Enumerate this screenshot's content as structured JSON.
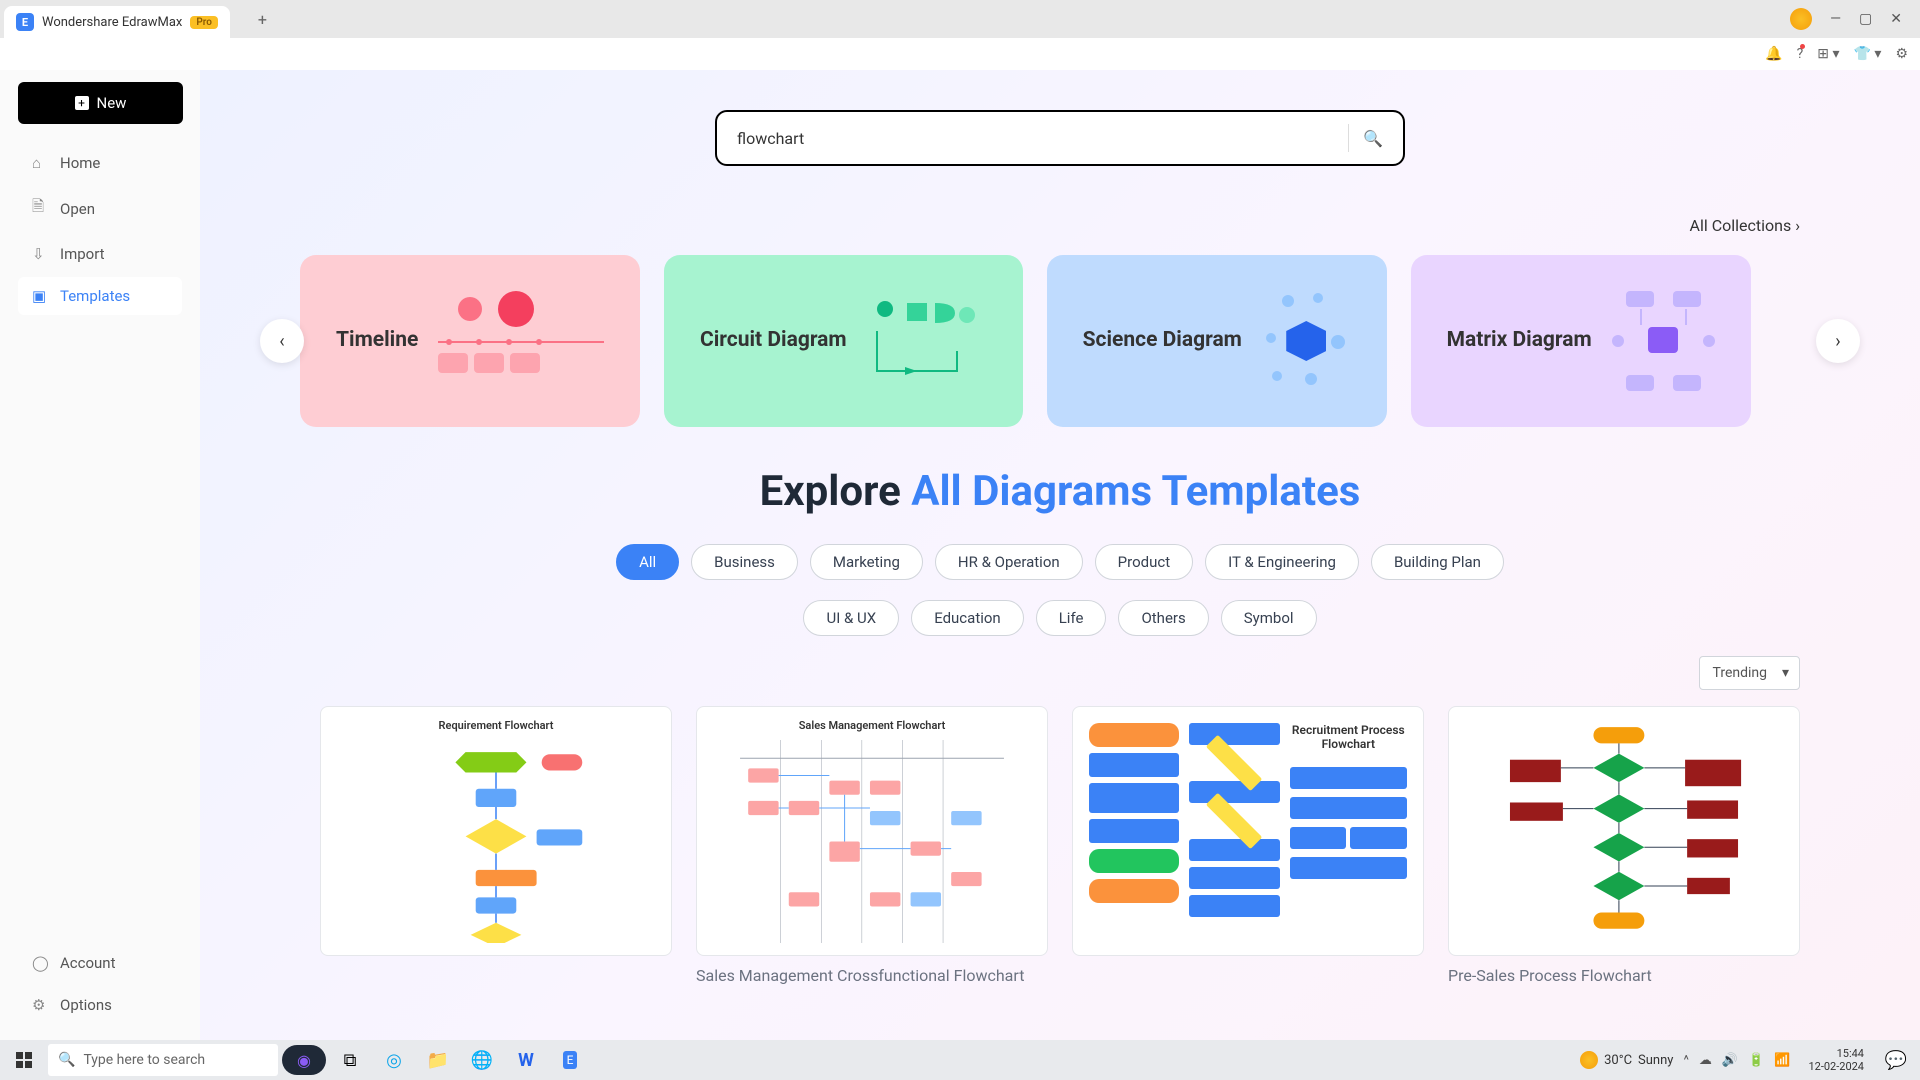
{
  "titlebar": {
    "app_name": "Wondershare EdrawMax",
    "badge": "Pro"
  },
  "toolbar": {
    "new_label": "New"
  },
  "sidebar": {
    "items": [
      {
        "label": "Home",
        "icon": "⌂"
      },
      {
        "label": "Open",
        "icon": "📄"
      },
      {
        "label": "Import",
        "icon": "⬇"
      },
      {
        "label": "Templates",
        "icon": "▣"
      }
    ],
    "footer": [
      {
        "label": "Account",
        "icon": "👤"
      },
      {
        "label": "Options",
        "icon": "⚙"
      }
    ]
  },
  "search": {
    "value": "flowchart"
  },
  "all_collections_label": "All Collections",
  "carousel": {
    "cards": [
      {
        "title": "Timeline"
      },
      {
        "title": "Circuit Diagram"
      },
      {
        "title": "Science Diagram"
      },
      {
        "title": "Matrix Diagram"
      }
    ]
  },
  "explore": {
    "prefix": "Explore ",
    "highlight": "All Diagrams Templates"
  },
  "categories_row1": [
    {
      "label": "All",
      "active": true
    },
    {
      "label": "Business"
    },
    {
      "label": "Marketing"
    },
    {
      "label": "HR & Operation"
    },
    {
      "label": "Product"
    },
    {
      "label": "IT & Engineering"
    },
    {
      "label": "Building Plan"
    }
  ],
  "categories_row2": [
    {
      "label": "UI & UX"
    },
    {
      "label": "Education"
    },
    {
      "label": "Life"
    },
    {
      "label": "Others"
    },
    {
      "label": "Symbol"
    }
  ],
  "sort": {
    "label": "Trending"
  },
  "templates": [
    {
      "thumb_title": "Requirement Flowchart",
      "caption": ""
    },
    {
      "thumb_title": "Sales Management Flowchart",
      "caption": "Sales Management Crossfunctional Flowchart"
    },
    {
      "thumb_title": "Recruitment Process Flowchart",
      "caption": ""
    },
    {
      "thumb_title": "",
      "caption": "Pre-Sales Process Flowchart"
    }
  ],
  "taskbar": {
    "search_placeholder": "Type here to search",
    "weather_temp": "30°C",
    "weather_cond": "Sunny",
    "time": "15:44",
    "date": "12-02-2024"
  }
}
